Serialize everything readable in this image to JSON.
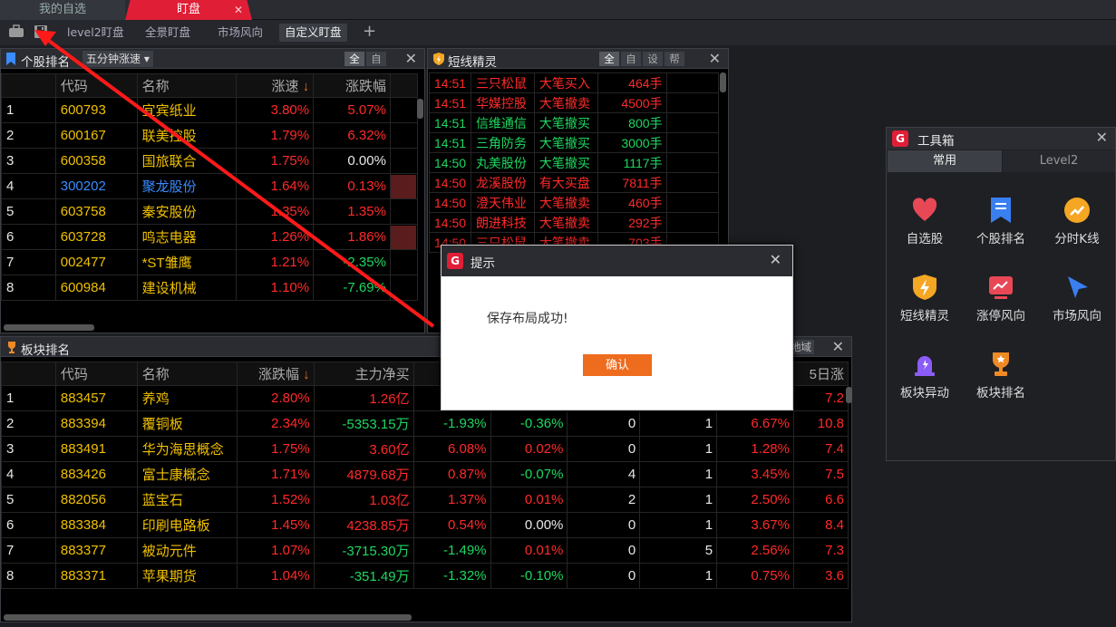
{
  "top_tabs": [
    {
      "label": "我的自选"
    },
    {
      "label": "盯盘",
      "close": "✕"
    }
  ],
  "layout_tabs": [
    "level2盯盘",
    "全景盯盘",
    "市场风向",
    "自定义盯盘"
  ],
  "stock_rank": {
    "title": "个股排名",
    "dropdown": "五分钟涨速",
    "seg": [
      "全",
      "自"
    ],
    "headers": [
      "代码",
      "名称",
      "涨速",
      "涨跌幅"
    ],
    "rows": [
      {
        "n": "1",
        "code": "600793",
        "name": "宜宾纸业",
        "speed": "3.80%",
        "chg": "5.07%",
        "cc": "r"
      },
      {
        "n": "2",
        "code": "600167",
        "name": "联美控股",
        "speed": "1.79%",
        "chg": "6.32%",
        "cc": "r"
      },
      {
        "n": "3",
        "code": "600358",
        "name": "国旅联合",
        "speed": "1.75%",
        "chg": "0.00%",
        "cc": "w"
      },
      {
        "n": "4",
        "code": "300202",
        "name": "聚龙股份",
        "speed": "1.64%",
        "chg": "0.13%",
        "cc": "r",
        "blue": true
      },
      {
        "n": "5",
        "code": "603758",
        "name": "秦安股份",
        "speed": "1.35%",
        "chg": "1.35%",
        "cc": "r"
      },
      {
        "n": "6",
        "code": "603728",
        "name": "鸣志电器",
        "speed": "1.26%",
        "chg": "1.86%",
        "cc": "r"
      },
      {
        "n": "7",
        "code": "002477",
        "name": "*ST雏鹰",
        "speed": "1.21%",
        "chg": "-2.35%",
        "cc": "g"
      },
      {
        "n": "8",
        "code": "600984",
        "name": "建设机械",
        "speed": "1.10%",
        "chg": "-7.69%",
        "cc": "g"
      }
    ]
  },
  "short_elf": {
    "title": "短线精灵",
    "seg": [
      "全",
      "自",
      "设",
      "帮"
    ],
    "rows": [
      {
        "t": "14:51",
        "name": "三只松鼠",
        "ev": "大笔买入",
        "vol": "464手",
        "c": "r"
      },
      {
        "t": "14:51",
        "name": "华媒控股",
        "ev": "大笔撤卖",
        "vol": "4500手",
        "c": "r"
      },
      {
        "t": "14:51",
        "name": "信维通信",
        "ev": "大笔撤买",
        "vol": "800手",
        "c": "g"
      },
      {
        "t": "14:51",
        "name": "三角防务",
        "ev": "大笔撤买",
        "vol": "3000手",
        "c": "g"
      },
      {
        "t": "14:50",
        "name": "丸美股份",
        "ev": "大笔撤买",
        "vol": "1117手",
        "c": "g"
      },
      {
        "t": "14:50",
        "name": "龙溪股份",
        "ev": "有大买盘",
        "vol": "7811手",
        "c": "r"
      },
      {
        "t": "14:50",
        "name": "澄天伟业",
        "ev": "大笔撤卖",
        "vol": "460手",
        "c": "r"
      },
      {
        "t": "14:50",
        "name": "朗进科技",
        "ev": "大笔撤卖",
        "vol": "292手",
        "c": "r"
      },
      {
        "t": "14:50",
        "name": "三只松鼠",
        "ev": "大笔撤卖",
        "vol": "703手",
        "c": "r"
      }
    ]
  },
  "sector_rank": {
    "title": "板块排名",
    "right_btn": "地域",
    "headers": [
      "代码",
      "名称",
      "涨跌幅",
      "主力净买",
      "",
      "",
      "",
      "",
      "",
      "5日涨"
    ],
    "rows": [
      {
        "n": "1",
        "code": "883457",
        "name": "养鸡",
        "chg": "2.80%",
        "net": "1.26亿",
        "c3": "",
        "c4": "",
        "c5": "",
        "c6": "",
        "c7": "",
        "c8": "7.2"
      },
      {
        "n": "2",
        "code": "883394",
        "name": "覆铜板",
        "chg": "2.34%",
        "net": "-5353.15万",
        "c3": "-1.93%",
        "c4": "-0.36%",
        "c5": "0",
        "c6": "1",
        "c7": "6.67%",
        "c8": "10.8"
      },
      {
        "n": "3",
        "code": "883491",
        "name": "华为海思概念",
        "chg": "1.75%",
        "net": "3.60亿",
        "c3": "6.08%",
        "c4": "0.02%",
        "c5": "0",
        "c6": "1",
        "c7": "1.28%",
        "c8": "7.4"
      },
      {
        "n": "4",
        "code": "883426",
        "name": "富士康概念",
        "chg": "1.71%",
        "net": "4879.68万",
        "c3": "0.87%",
        "c4": "-0.07%",
        "c5": "4",
        "c6": "1",
        "c7": "3.45%",
        "c8": "7.5"
      },
      {
        "n": "5",
        "code": "882056",
        "name": "蓝宝石",
        "chg": "1.52%",
        "net": "1.03亿",
        "c3": "1.37%",
        "c4": "0.01%",
        "c5": "2",
        "c6": "1",
        "c7": "2.50%",
        "c8": "6.6"
      },
      {
        "n": "6",
        "code": "883384",
        "name": "印刷电路板",
        "chg": "1.45%",
        "net": "4238.85万",
        "c3": "0.54%",
        "c4": "0.00%",
        "c5": "0",
        "c6": "1",
        "c7": "3.67%",
        "c8": "8.4"
      },
      {
        "n": "7",
        "code": "883377",
        "name": "被动元件",
        "chg": "1.07%",
        "net": "-3715.30万",
        "c3": "-1.49%",
        "c4": "0.01%",
        "c5": "0",
        "c6": "5",
        "c7": "2.56%",
        "c8": "7.3"
      },
      {
        "n": "8",
        "code": "883371",
        "name": "苹果期货",
        "chg": "1.04%",
        "net": "-351.49万",
        "c3": "-1.32%",
        "c4": "-0.10%",
        "c5": "0",
        "c6": "1",
        "c7": "0.75%",
        "c8": "3.6"
      }
    ]
  },
  "dialog": {
    "title": "提示",
    "message": "保存布局成功!",
    "ok": "确认"
  },
  "toolbox": {
    "title": "工具箱",
    "tabs": [
      "常用",
      "Level2"
    ],
    "items": [
      {
        "label": "自选股",
        "icon": "heart-icon"
      },
      {
        "label": "个股排名",
        "icon": "bookmark-list-icon"
      },
      {
        "label": "分时K线",
        "icon": "trend-arrow-icon"
      },
      {
        "label": "短线精灵",
        "icon": "shield-bolt-icon"
      },
      {
        "label": "涨停风向",
        "icon": "chart-card-icon"
      },
      {
        "label": "市场风向",
        "icon": "cursor-arrow-icon"
      },
      {
        "label": "板块异动",
        "icon": "siren-icon"
      },
      {
        "label": "板块排名",
        "icon": "trophy-icon"
      }
    ]
  },
  "colors": {
    "accent": "#e01e36",
    "up": "#ff2a2a",
    "down": "#1ed760",
    "code": "#f0c000",
    "button": "#ee6c1e"
  }
}
